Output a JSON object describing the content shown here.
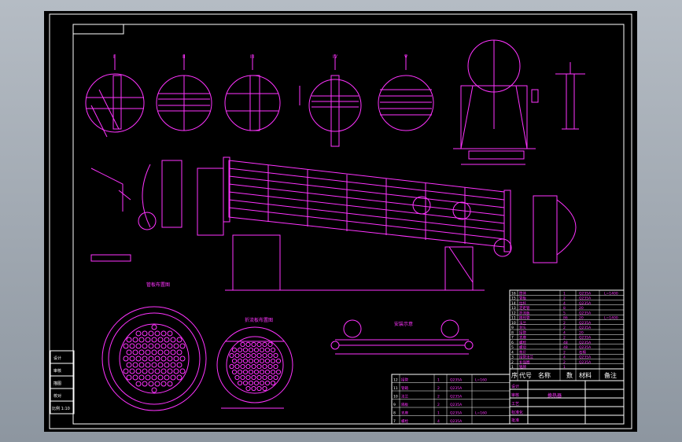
{
  "detail_labels": [
    "I",
    "II",
    "III",
    "IV",
    "V"
  ],
  "view_labels": [
    "管板布置图",
    "折流板布置图",
    "安装示意"
  ],
  "left_title_block": [
    "设计",
    "审核",
    "描图",
    "校对",
    "比例 1:10"
  ],
  "bom_header": [
    "序",
    "代号",
    "名称",
    "数",
    "材料",
    "备注"
  ],
  "bom_rows": [
    [
      "16",
      "筒体",
      "1",
      "Q235A",
      "L=1400"
    ],
    [
      "15",
      "管板",
      "2",
      "Q235A",
      ""
    ],
    [
      "14",
      "拉杆",
      "4",
      "Q235A",
      ""
    ],
    [
      "13",
      "定距管",
      "8",
      "20",
      ""
    ],
    [
      "12",
      "折流板",
      "5",
      "Q235A",
      ""
    ],
    [
      "11",
      "换热管",
      "86",
      "20",
      "L=1400"
    ],
    [
      "10",
      "法兰",
      "2",
      "Q235A",
      ""
    ],
    [
      "9",
      "封头",
      "2",
      "Q235A",
      ""
    ],
    [
      "8",
      "接管",
      "4",
      "20",
      ""
    ],
    [
      "7",
      "支座",
      "2",
      "Q235A",
      ""
    ],
    [
      "6",
      "螺栓",
      "48",
      "Q235A",
      ""
    ],
    [
      "5",
      "螺母",
      "48",
      "Q235A",
      ""
    ],
    [
      "4",
      "垫片",
      "2",
      "石棉",
      ""
    ],
    [
      "3",
      "接管法兰",
      "4",
      "Q235A",
      ""
    ],
    [
      "2",
      "补强圈",
      "2",
      "Q235A",
      ""
    ],
    [
      "1",
      "铭牌",
      "1",
      "",
      ""
    ]
  ],
  "lower_table_rows": [
    [
      "12",
      "接管",
      "1",
      "Q235A",
      "L=160"
    ],
    [
      "11",
      "管箱",
      "2",
      "Q235A",
      ""
    ],
    [
      "10",
      "法兰",
      "2",
      "Q235A",
      ""
    ],
    [
      "9",
      "隔板",
      "2",
      "Q235A",
      ""
    ],
    [
      "8",
      "支座",
      "1",
      "Q235A",
      "L=160"
    ],
    [
      "7",
      "螺栓",
      "4",
      "Q235A",
      ""
    ]
  ],
  "title_block": {
    "drawing_title": "换热器",
    "rows": [
      "设计",
      "审核",
      "工艺",
      "标准化",
      "批准"
    ]
  },
  "colors": {
    "drawing": "#ff33ff",
    "frame": "#ffffff",
    "background": "#000000"
  }
}
